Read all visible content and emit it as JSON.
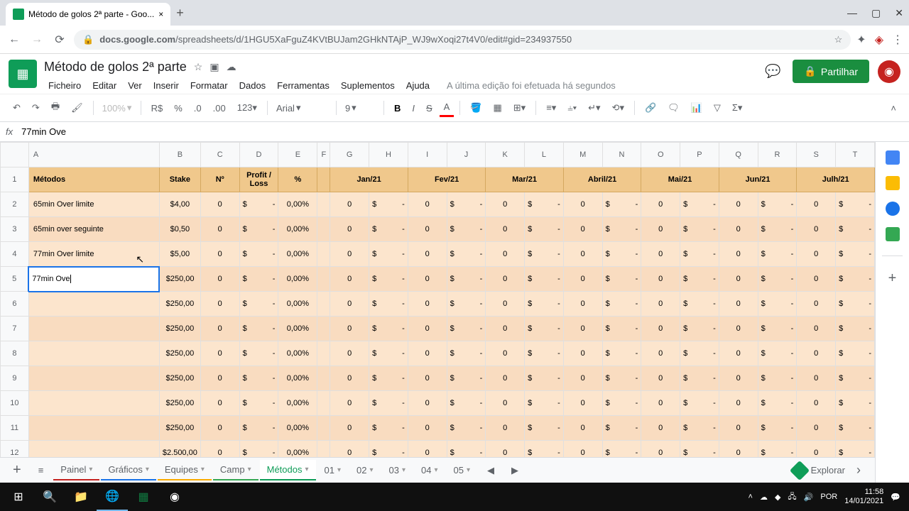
{
  "browser": {
    "tab_title": "Método de golos 2ª parte - Goo...",
    "url_prefix": "docs.google.com",
    "url_path": "/spreadsheets/d/1HGU5XaFguZ4KVtBUJam2GHkNTAjP_WJ9wXoqi27t4V0/edit#gid=234937550"
  },
  "doc": {
    "title": "Método de golos 2ª parte",
    "edit_status": "A última edição foi efetuada há segundos",
    "share_label": "Partilhar"
  },
  "menu": [
    "Ficheiro",
    "Editar",
    "Ver",
    "Inserir",
    "Formatar",
    "Dados",
    "Ferramentas",
    "Suplementos",
    "Ajuda"
  ],
  "toolbar": {
    "zoom": "100%",
    "currency": "R$",
    "font": "Arial",
    "font_size": "9"
  },
  "formula_bar": {
    "value": "77min Ove"
  },
  "columns": [
    "A",
    "B",
    "C",
    "D",
    "E",
    "F",
    "G",
    "H",
    "I",
    "J",
    "K",
    "L",
    "M",
    "N",
    "O",
    "P",
    "Q",
    "R",
    "S",
    "T"
  ],
  "headers": {
    "A": "Métodos",
    "B": "Stake",
    "C": "Nº",
    "D": "Profit / Loss",
    "E": "%",
    "GH": "Jan/21",
    "IJ": "Fev/21",
    "KL": "Mar/21",
    "MN": "Abril/21",
    "OP": "Mai/21",
    "QR": "Jun/21",
    "ST": "Julh/21"
  },
  "rows": [
    {
      "n": 2,
      "method": "65min Over limite",
      "stake": "$4,00",
      "num": "0",
      "pl_sym": "$",
      "pl": "-",
      "pct": "0,00%"
    },
    {
      "n": 3,
      "method": "65min over seguinte",
      "stake": "$0,50",
      "num": "0",
      "pl_sym": "$",
      "pl": "-",
      "pct": "0,00%"
    },
    {
      "n": 4,
      "method": "77min Over limite",
      "stake": "$5,00",
      "num": "0",
      "pl_sym": "$",
      "pl": "-",
      "pct": "0,00%"
    },
    {
      "n": 5,
      "method": "77min Ove",
      "editing": true,
      "stake": "$250,00",
      "num": "0",
      "pl_sym": "$",
      "pl": "-",
      "pct": "0,00%"
    },
    {
      "n": 6,
      "method": "",
      "stake": "$250,00",
      "num": "0",
      "pl_sym": "$",
      "pl": "-",
      "pct": "0,00%"
    },
    {
      "n": 7,
      "method": "",
      "stake": "$250,00",
      "num": "0",
      "pl_sym": "$",
      "pl": "-",
      "pct": "0,00%"
    },
    {
      "n": 8,
      "method": "",
      "stake": "$250,00",
      "num": "0",
      "pl_sym": "$",
      "pl": "-",
      "pct": "0,00%"
    },
    {
      "n": 9,
      "method": "",
      "stake": "$250,00",
      "num": "0",
      "pl_sym": "$",
      "pl": "-",
      "pct": "0,00%"
    },
    {
      "n": 10,
      "method": "",
      "stake": "$250,00",
      "num": "0",
      "pl_sym": "$",
      "pl": "-",
      "pct": "0,00%"
    },
    {
      "n": 11,
      "method": "",
      "stake": "$250,00",
      "num": "0",
      "pl_sym": "$",
      "pl": "-",
      "pct": "0,00%"
    },
    {
      "n": 12,
      "method": "",
      "stake": "$2.500,00",
      "num": "0",
      "pl_sym": "$",
      "pl": "-",
      "pct": "0,00%"
    }
  ],
  "month_cells": {
    "zero": "0",
    "sym": "$",
    "dash": "-"
  },
  "sheet_tabs": [
    {
      "label": "Painel",
      "color": "#c5221f"
    },
    {
      "label": "Gráficos",
      "color": "#1a73e8"
    },
    {
      "label": "Equipes",
      "color": "#f9ab00"
    },
    {
      "label": "Camp",
      "color": "#34a853"
    },
    {
      "label": "Métodos",
      "active": true
    },
    {
      "label": "01"
    },
    {
      "label": "02"
    },
    {
      "label": "03"
    },
    {
      "label": "04"
    },
    {
      "label": "05"
    }
  ],
  "explore_label": "Explorar",
  "clock": {
    "time": "11:58",
    "date": "14/01/2021"
  }
}
